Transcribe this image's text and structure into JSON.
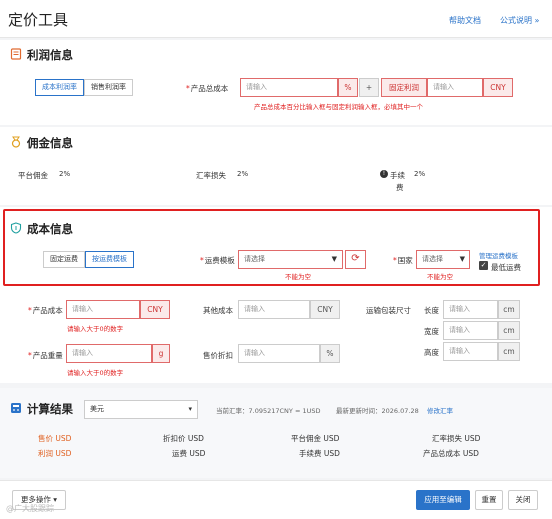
{
  "header": {
    "title": "定价工具",
    "help_link": "帮助文档",
    "formula_link": "公式说明 »"
  },
  "profit": {
    "title": "利润信息",
    "seg": [
      "成本利润率",
      "销售利润率"
    ],
    "total_cost_label": "产品总成本",
    "input_placeholder": "请输入",
    "percent": "%",
    "plus": "+",
    "fixed_profit": "固定利润",
    "currency": "CNY",
    "hint": "产品总成本百分比输入框与固定利润输入框，必填其中一个"
  },
  "commission": {
    "title": "佣金信息",
    "platform_label": "平台佣金",
    "platform_value": "2%",
    "fx_label": "汇率损失",
    "fx_value": "2%",
    "fee_label_1": "手续",
    "fee_label_2": "费",
    "fee_value": "2%"
  },
  "cost": {
    "title": "成本信息",
    "seg": [
      "固定运费",
      "按运费模板"
    ],
    "freight_template_label": "运费模板",
    "select_placeholder": "请选择",
    "required_err": "不能为空",
    "country_label": "国家",
    "manage_link": "管理运费模板",
    "cheapest_label": "最低运费",
    "product_cost_label": "产品成本",
    "currency": "CNY",
    "gt0_err": "请输入大于0的数字",
    "other_cost_label": "其他成本",
    "package_label": "运输包装尺寸",
    "length": "长度",
    "width": "宽度",
    "height": "高度",
    "unit_cm": "cm",
    "weight_label": "产品重量",
    "unit_g": "g",
    "discount_label": "售价折扣",
    "percent": "%",
    "input_placeholder": "请输入"
  },
  "result": {
    "title": "计算结果",
    "currency_select": "美元",
    "rate_text": "当前汇率：7.095217CNY = 1USD",
    "updated_text": "最新更新时间：2026.07.28",
    "edit_rate": "修改汇率",
    "row1": [
      "售价 USD",
      "折扣价 USD",
      "平台佣金 USD",
      "汇率损失 USD"
    ],
    "row2": [
      "利润 USD",
      "运费 USD",
      "手续费 USD",
      "产品总成本 USD"
    ]
  },
  "footer": {
    "more_actions": "更多操作",
    "apply": "应用至编辑",
    "reset": "重置",
    "close": "关闭"
  },
  "watermark": "@广大股跟踪"
}
